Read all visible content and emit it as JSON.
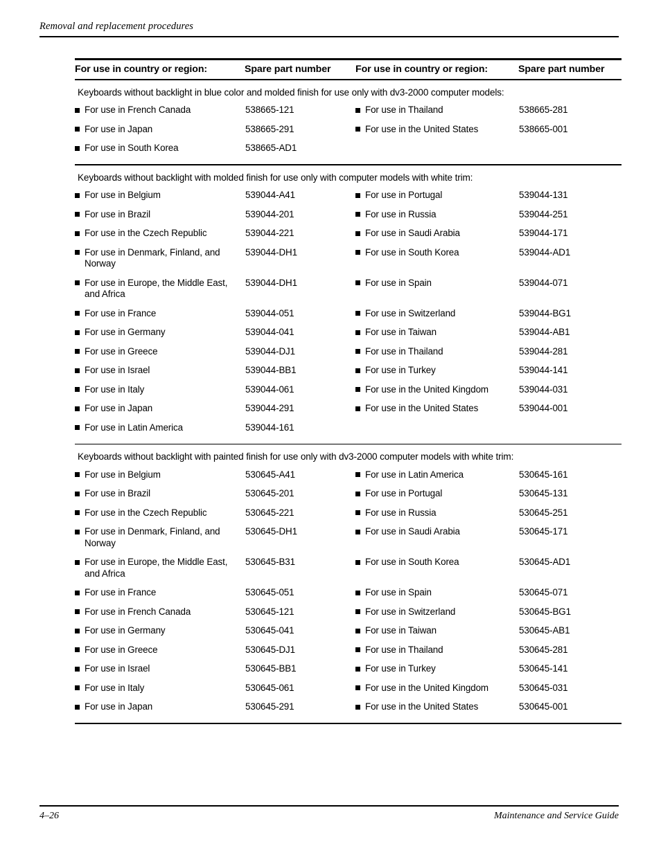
{
  "page": {
    "running_head": "Removal and replacement procedures",
    "footer_page_number": "4–26",
    "footer_guide_title": "Maintenance and Service Guide"
  },
  "table": {
    "headers": [
      "For use in country or region:",
      "Spare part number",
      "For use in country or region:",
      "Spare part number"
    ],
    "sections": [
      {
        "caption": "Keyboards without backlight in blue color and molded finish for use only with dv3-2000 computer models:",
        "rows": [
          {
            "left_region": "For use in French Canada",
            "left_part": "538665-121",
            "right_region": "For use in Thailand",
            "right_part": "538665-281"
          },
          {
            "left_region": "For use in Japan",
            "left_part": "538665-291",
            "right_region": "For use in the United States",
            "right_part": "538665-001"
          },
          {
            "left_region": "For use in South Korea",
            "left_part": "538665-AD1",
            "right_region": "",
            "right_part": ""
          }
        ]
      },
      {
        "caption": "Keyboards without backlight with molded finish for use only with computer models with white trim:",
        "rows": [
          {
            "left_region": "For use in Belgium",
            "left_part": "539044-A41",
            "right_region": "For use in Portugal",
            "right_part": "539044-131"
          },
          {
            "left_region": "For use in Brazil",
            "left_part": "539044-201",
            "right_region": "For use in Russia",
            "right_part": "539044-251"
          },
          {
            "left_region": "For use in the Czech Republic",
            "left_part": "539044-221",
            "right_region": "For use in Saudi Arabia",
            "right_part": "539044-171"
          },
          {
            "left_region": "For use in Denmark, Finland, and Norway",
            "left_part": "539044-DH1",
            "right_region": "For use in South Korea",
            "right_part": "539044-AD1"
          },
          {
            "left_region": "For use in Europe, the Middle East, and Africa",
            "left_part": "539044-DH1",
            "right_region": "For use in Spain",
            "right_part": "539044-071"
          },
          {
            "left_region": "For use in France",
            "left_part": "539044-051",
            "right_region": "For use in Switzerland",
            "right_part": "539044-BG1"
          },
          {
            "left_region": "For use in Germany",
            "left_part": "539044-041",
            "right_region": "For use in Taiwan",
            "right_part": "539044-AB1"
          },
          {
            "left_region": "For use in Greece",
            "left_part": "539044-DJ1",
            "right_region": "For use in Thailand",
            "right_part": "539044-281"
          },
          {
            "left_region": "For use in Israel",
            "left_part": "539044-BB1",
            "right_region": "For use in Turkey",
            "right_part": "539044-141"
          },
          {
            "left_region": "For use in Italy",
            "left_part": "539044-061",
            "right_region": "For use in the United Kingdom",
            "right_part": "539044-031"
          },
          {
            "left_region": "For use in Japan",
            "left_part": "539044-291",
            "right_region": "For use in the United States",
            "right_part": "539044-001"
          },
          {
            "left_region": "For use in Latin America",
            "left_part": "539044-161",
            "right_region": "",
            "right_part": ""
          }
        ]
      },
      {
        "caption": "Keyboards without backlight with painted finish for use only with dv3-2000 computer models with white trim:",
        "rows": [
          {
            "left_region": "For use in Belgium",
            "left_part": "530645-A41",
            "right_region": "For use in Latin America",
            "right_part": "530645-161"
          },
          {
            "left_region": "For use in Brazil",
            "left_part": "530645-201",
            "right_region": "For use in Portugal",
            "right_part": "530645-131"
          },
          {
            "left_region": "For use in the Czech Republic",
            "left_part": "530645-221",
            "right_region": "For use in Russia",
            "right_part": "530645-251"
          },
          {
            "left_region": "For use in Denmark, Finland, and Norway",
            "left_part": "530645-DH1",
            "right_region": "For use in Saudi Arabia",
            "right_part": "530645-171"
          },
          {
            "left_region": "For use in Europe, the Middle East, and Africa",
            "left_part": "530645-B31",
            "right_region": "For use in South Korea",
            "right_part": "530645-AD1"
          },
          {
            "left_region": "For use in France",
            "left_part": "530645-051",
            "right_region": "For use in Spain",
            "right_part": "530645-071"
          },
          {
            "left_region": "For use in French Canada",
            "left_part": "530645-121",
            "right_region": "For use in Switzerland",
            "right_part": "530645-BG1"
          },
          {
            "left_region": "For use in Germany",
            "left_part": "530645-041",
            "right_region": "For use in Taiwan",
            "right_part": "530645-AB1"
          },
          {
            "left_region": "For use in Greece",
            "left_part": "530645-DJ1",
            "right_region": "For use in Thailand",
            "right_part": "530645-281"
          },
          {
            "left_region": "For use in Israel",
            "left_part": "530645-BB1",
            "right_region": "For use in Turkey",
            "right_part": "530645-141"
          },
          {
            "left_region": "For use in Italy",
            "left_part": "530645-061",
            "right_region": "For use in the United Kingdom",
            "right_part": "530645-031"
          },
          {
            "left_region": "For use in Japan",
            "left_part": "530645-291",
            "right_region": "For use in the United States",
            "right_part": "530645-001"
          }
        ]
      }
    ]
  }
}
